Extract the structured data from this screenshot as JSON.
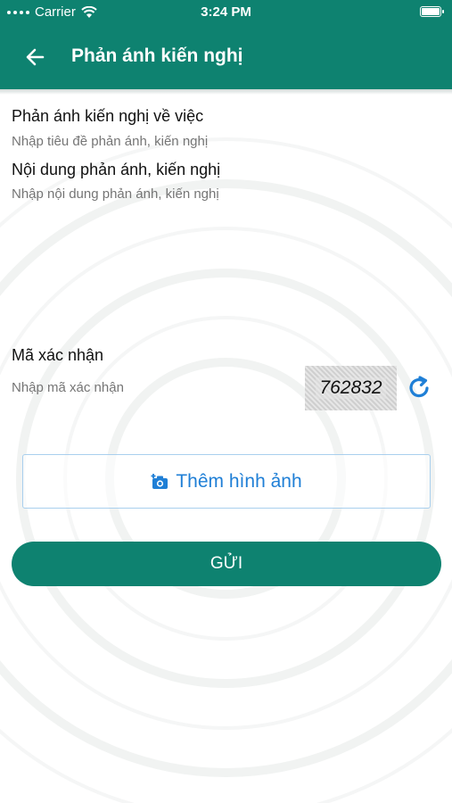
{
  "status_bar": {
    "carrier": "Carrier",
    "time": "3:24 PM"
  },
  "header": {
    "title": "Phản ánh kiến nghị",
    "back_icon": "arrow-left-icon"
  },
  "form": {
    "subject_label": "Phản ánh kiến nghị về việc",
    "subject_placeholder": "Nhập tiêu đề phản ánh, kiến nghị",
    "content_label": "Nội dung phản ánh, kiến nghị",
    "content_placeholder": "Nhập nội dung phản ánh, kiến nghị",
    "captcha_label": "Mã xác nhận",
    "captcha_placeholder": "Nhập mã xác nhận",
    "captcha_code": "762832",
    "refresh_icon": "refresh-icon",
    "add_image_label": "Thêm hình ảnh",
    "add_image_icon": "camera-plus-icon",
    "submit_label": "GỬI"
  },
  "colors": {
    "primary": "#0e8270",
    "accent_blue": "#1f7fd6",
    "placeholder": "#dcdcdc"
  }
}
